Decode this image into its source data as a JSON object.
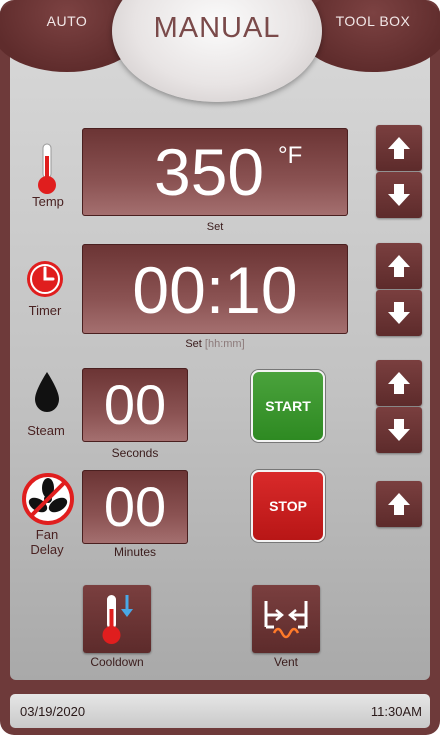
{
  "tabs": {
    "auto": "AUTO",
    "manual": "MANUAL",
    "toolbox": "TOOL BOX",
    "active": "MANUAL"
  },
  "temp": {
    "label": "Temp",
    "value": "350",
    "unit": "°F",
    "caption": "Set"
  },
  "timer": {
    "label": "Timer",
    "value": "00:10",
    "caption": "Set",
    "caption_format": "[hh:mm]"
  },
  "steam": {
    "label": "Steam",
    "value": "00",
    "caption": "Seconds"
  },
  "fan_delay": {
    "label": "Fan Delay",
    "value": "00",
    "caption": "Minutes"
  },
  "actions": {
    "start": "START",
    "stop": "STOP"
  },
  "bottom": {
    "cooldown": "Cooldown",
    "vent": "Vent"
  },
  "status": {
    "date": "03/19/2020",
    "time": "11:30AM"
  },
  "icons": {
    "temp": "thermometer-icon",
    "timer": "clock-icon",
    "steam": "water-drop-icon",
    "fan_delay": "fan-off-icon",
    "cooldown": "thermometer-cooldown-icon",
    "vent": "vent-icon",
    "up": "arrow-up-icon",
    "down": "arrow-down-icon"
  },
  "colors": {
    "frame": "#6e3a3a",
    "display": "#7a4040",
    "start": "#3a9a2e",
    "stop": "#cc1f1f",
    "accent_red": "#e01e1e"
  }
}
